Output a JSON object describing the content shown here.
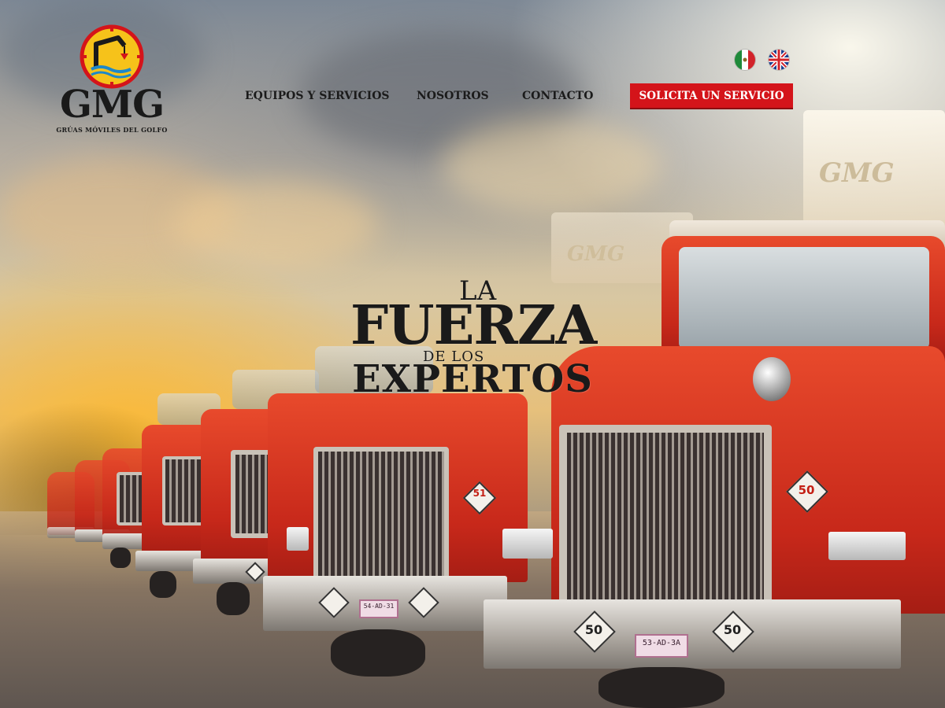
{
  "brand": {
    "logo_text": "GMG",
    "logo_subtitle": "GRÚAS MÓVILES DEL GOLFO"
  },
  "nav": {
    "items": [
      {
        "label": "EQUIPOS Y SERVICIOS"
      },
      {
        "label": "NOSOTROS"
      },
      {
        "label": "CONTACTO"
      }
    ],
    "cta_label": "SOLICITA UN SERVICIO"
  },
  "languages": [
    {
      "icon": "mexico-flag-icon"
    },
    {
      "icon": "uk-flag-icon"
    }
  ],
  "hero": {
    "headline_line1": "LA",
    "headline_line2": "FUERZA",
    "headline_line3": "DE LOS",
    "headline_line4": "EXPERTOS",
    "front_truck_number": "50",
    "front_truck_plate": "53-AD-3A",
    "second_truck_number": "51",
    "second_truck_plate": "54-AD-31",
    "trailer_logo": "GMG"
  },
  "colors": {
    "accent_red": "#d4141a",
    "truck_red": "#d83420",
    "text_dark": "#1a1a1a"
  }
}
